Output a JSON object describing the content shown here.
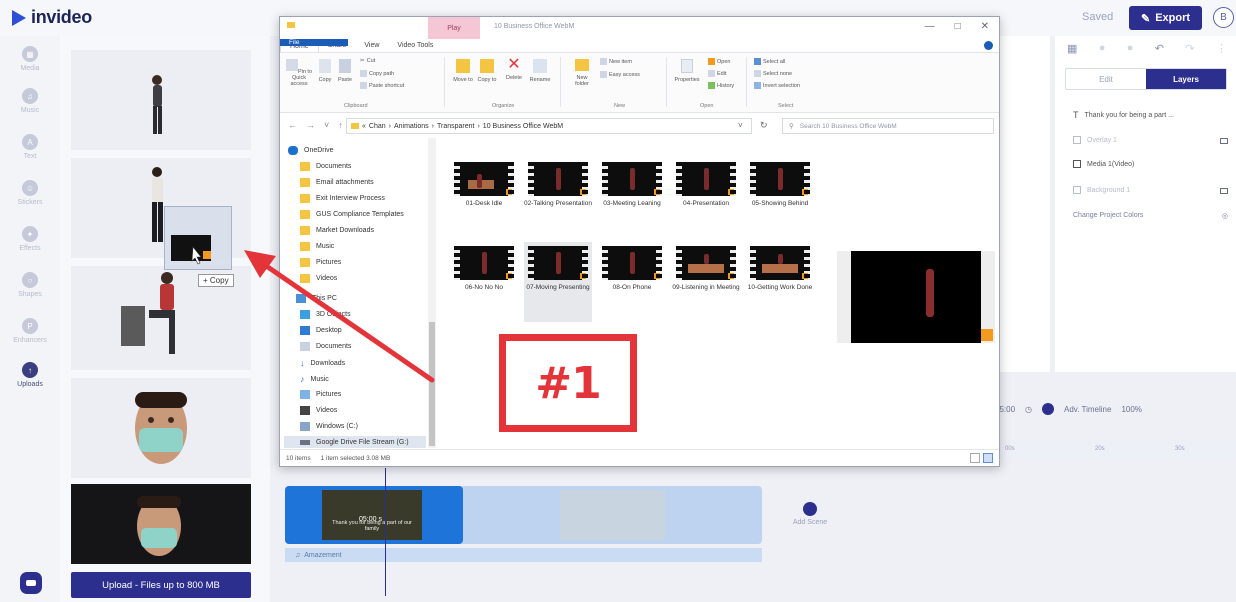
{
  "app": {
    "name": "invideo",
    "saved_label": "Saved",
    "export_label": "Export",
    "avatar_initial": "B",
    "brand_color": "#2d2f8f"
  },
  "sidebar": {
    "items": [
      {
        "label": "Media",
        "icon": "media-icon"
      },
      {
        "label": "Music",
        "icon": "music-icon"
      },
      {
        "label": "Text",
        "icon": "text-icon"
      },
      {
        "label": "Stickers",
        "icon": "stickers-icon"
      },
      {
        "label": "Effects",
        "icon": "effects-icon"
      },
      {
        "label": "Shapes",
        "icon": "shapes-icon"
      },
      {
        "label": "Enhancers",
        "icon": "enhancers-icon"
      },
      {
        "label": "Uploads",
        "icon": "uploads-icon"
      }
    ]
  },
  "media_panel": {
    "upload_label": "Upload - Files up to 800 MB",
    "copy_tooltip": "+ Copy"
  },
  "right_panel": {
    "tabs": [
      "Edit",
      "Layers"
    ],
    "layers": [
      {
        "label": "Thank you for being a part ..."
      },
      {
        "label": "Overlay 1"
      },
      {
        "label": "Media 1(Video)"
      },
      {
        "label": "Background 1"
      }
    ],
    "change_colors": "Change Project Colors"
  },
  "timeline": {
    "time": "05:00",
    "adv_label": "Adv. Timeline",
    "zoom": "100%",
    "ruler_marks": [
      "00s",
      "20s",
      "30s"
    ],
    "clip_duration": "05:00 s",
    "clip_caption": "Thank you for being a part of our family",
    "audio_label": "Amazement",
    "add_scene": "Add Scene"
  },
  "explorer": {
    "play_tab": "Play",
    "title": "10 Business Office WebM",
    "ribbon_tabs": [
      "File",
      "Home",
      "Share",
      "View",
      "Video Tools"
    ],
    "clipboard": {
      "pin_label": "Pin to Quick access",
      "copy_label": "Copy",
      "paste_label": "Paste",
      "cut_label": "Cut",
      "copy_path_label": "Copy path",
      "paste_shortcut_label": "Paste shortcut",
      "group_label": "Clipboard"
    },
    "organize": {
      "move_label": "Move to",
      "copy_to_label": "Copy to",
      "delete_label": "Delete",
      "rename_label": "Rename",
      "group_label": "Organize"
    },
    "new": {
      "new_folder_label": "New folder",
      "new_item_label": "New item",
      "easy_access_label": "Easy access",
      "group_label": "New"
    },
    "open": {
      "properties_label": "Properties",
      "open_label": "Open",
      "edit_label": "Edit",
      "history_label": "History",
      "group_label": "Open"
    },
    "select": {
      "select_all_label": "Select all",
      "select_none_label": "Select none",
      "invert_label": "Invert selection",
      "group_label": "Select"
    },
    "breadcrumb": [
      "Chan",
      "Animations",
      "Transparent",
      "10 Business Office WebM"
    ],
    "search_placeholder": "Search 10 Business Office WebM",
    "nav": [
      "OneDrive",
      "Documents",
      "Email attachments",
      "Exit Interview Process",
      "GUS Compliance Templates",
      "Market Downloads",
      "Music",
      "Pictures",
      "Videos",
      "This PC",
      "3D Objects",
      "Desktop",
      "Documents",
      "Downloads",
      "Music",
      "Pictures",
      "Videos",
      "Windows (C:)",
      "Google Drive File Stream (G:)"
    ],
    "files": [
      "01-Desk Idle",
      "02-Talking Presentation",
      "03-Meeting Leaning",
      "04-Presentation",
      "05-Showing Behind",
      "06-No No No",
      "07-Moving Presenting",
      "08-On Phone",
      "09-Listening in Meeting",
      "10-Getting Work Done"
    ],
    "status_items": "10 items",
    "status_selected": "1 item selected  3.08 MB"
  },
  "annotation": {
    "label": "#1",
    "color": "#e3343a"
  }
}
